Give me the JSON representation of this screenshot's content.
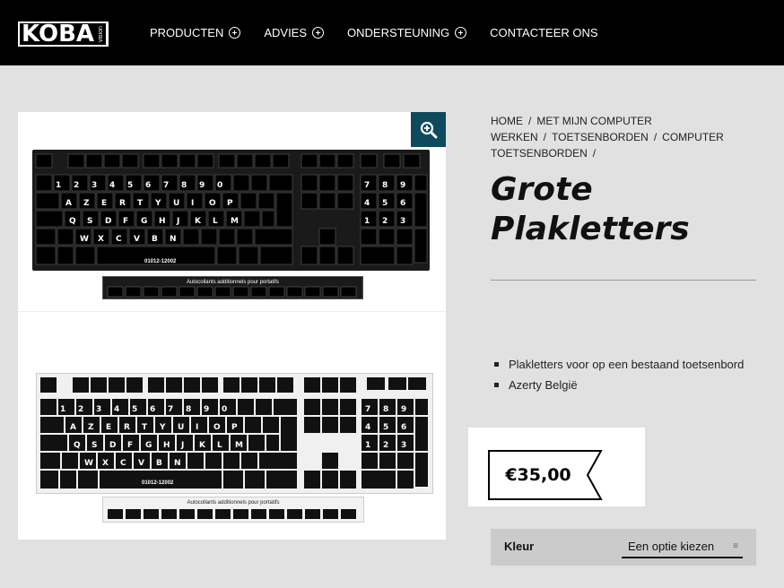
{
  "brand": {
    "name": "KOBA",
    "tagline": "vision"
  },
  "nav": {
    "items": [
      {
        "label": "PRODUCTEN",
        "expandable": true
      },
      {
        "label": "ADVIES",
        "expandable": true
      },
      {
        "label": "ONDERSTEUNING",
        "expandable": true
      },
      {
        "label": "CONTACTEER ONS",
        "expandable": false
      }
    ]
  },
  "gallery": {
    "zoom_icon": "zoom-in-icon",
    "image1": {
      "code": "01012-12002",
      "strip_caption": "Autocollants additionnels pour portatifs"
    },
    "image2": {
      "code": "01012-12002",
      "strip_caption": "Autocollants additionnels pour portatifs"
    }
  },
  "breadcrumb": {
    "items": [
      "HOME",
      "MET MIJN COMPUTER WERKEN",
      "TOETSENBORDEN",
      "COMPUTER TOETSENBORDEN"
    ],
    "separator": "/"
  },
  "product": {
    "title_line1": "Grote",
    "title_line2": "Plakletters",
    "features": [
      "Plakletters voor op een bestaand toetsenbord",
      "Azerty België"
    ],
    "price": "€35,00"
  },
  "variation": {
    "label": "Kleur",
    "selected": "Een optie kiezen"
  },
  "colors": {
    "header_bg": "#000000",
    "page_bg": "#e1e1e1",
    "accent": "#0f4a5c"
  }
}
